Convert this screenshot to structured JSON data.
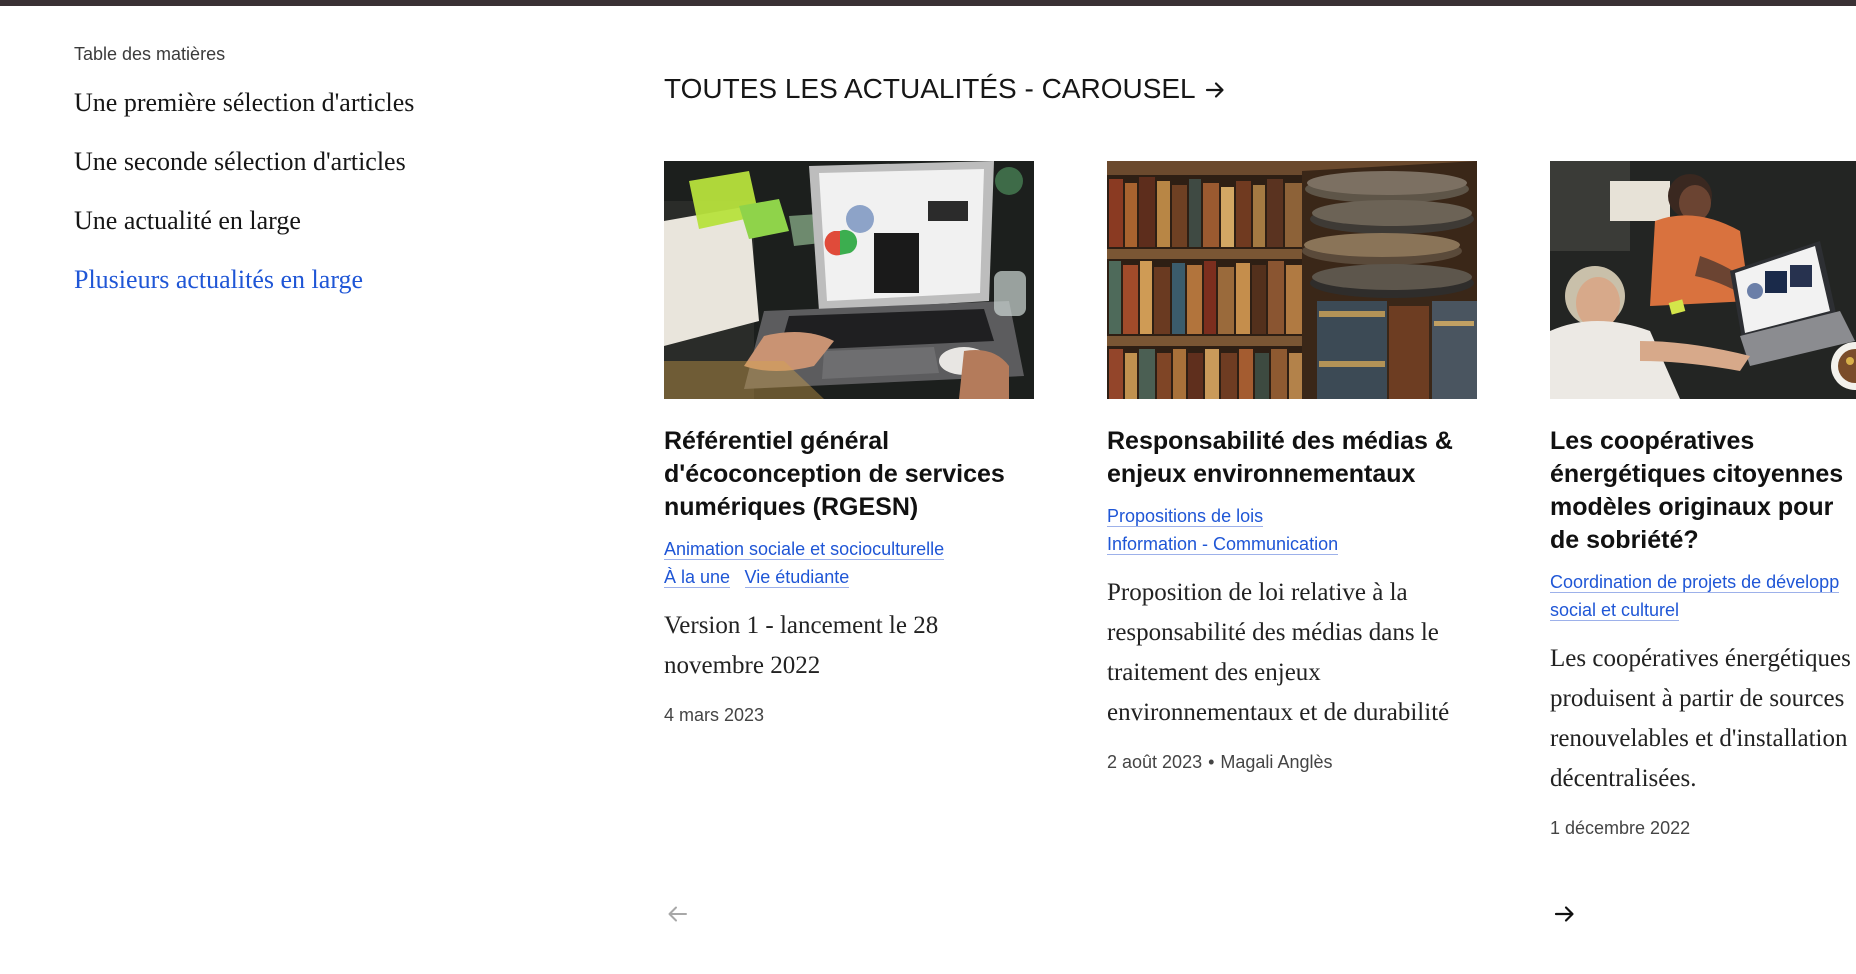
{
  "colors": {
    "accent": "#1f56d6",
    "text": "#111111",
    "muted": "#444444",
    "top_bar": "#3a3134"
  },
  "toc": {
    "title": "Table des matières",
    "items": [
      {
        "label": "Une première sélection d'articles",
        "active": false
      },
      {
        "label": "Une seconde sélection d'articles",
        "active": false
      },
      {
        "label": "Une actualité en large",
        "active": false
      },
      {
        "label": "Plusieurs actualités en large",
        "active": true
      }
    ]
  },
  "section": {
    "title": "TOUTES LES ACTUALITÉS - CAROUSEL",
    "arrow_icon": "arrow-right-icon"
  },
  "cards": [
    {
      "image": "laptop-workspace-photo",
      "title": "Référentiel général d'écoconception de services numériques (RGESN)",
      "tags": [
        "Animation sociale et socioculturelle",
        "À la une",
        "Vie étudiante"
      ],
      "description": "Version 1 - lancement le 28 novembre 2022",
      "date": "4 mars 2023",
      "author": ""
    },
    {
      "image": "library-books-photo",
      "title": "Responsabilité des médias & enjeux environnementaux",
      "tags": [
        "Propositions de lois",
        "Information - Communication"
      ],
      "description": "Proposition de loi relative à la responsabilité des médias dans le traitement des enjeux environnementaux et de durabilité",
      "date": "2 août 2023",
      "author": "Magali Anglès"
    },
    {
      "image": "team-meeting-photo",
      "title_lines": [
        "Les coopératives",
        "énergétiques citoyennes",
        "modèles originaux pour",
        "de sobriété?"
      ],
      "tags": [
        "Coordination de projets de développ",
        "social et culturel"
      ],
      "description_lines": [
        "Les coopératives énergétiques",
        "produisent à partir de sources",
        "renouvelables et d'installation",
        "décentralisées."
      ],
      "date": "1 décembre 2022"
    }
  ],
  "carousel_nav": {
    "prev_icon": "arrow-left-icon",
    "next_icon": "arrow-right-icon",
    "prev_enabled": false,
    "next_enabled": true
  }
}
